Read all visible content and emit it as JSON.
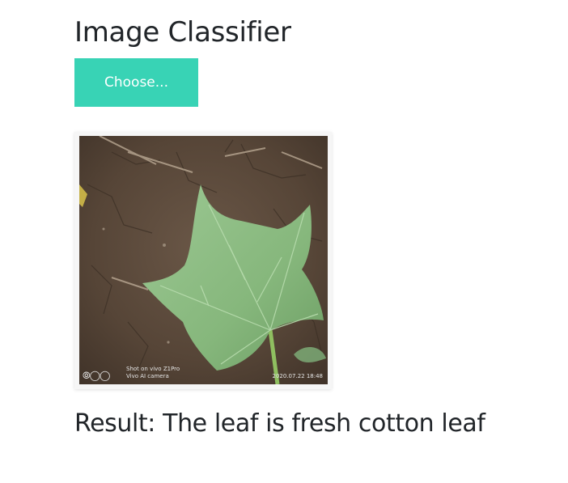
{
  "page": {
    "title": "Image Classifier",
    "choose_label": "Choose...",
    "result_text": "Result: The leaf is fresh cotton leaf"
  },
  "preview": {
    "watermark_logo": "⦾◯◯",
    "watermark_line1": "Shot on vivo Z1Pro",
    "watermark_line2": "Vivo AI camera",
    "watermark_date": "2020.07.22 18:48"
  },
  "colors": {
    "accent": "#38d3b5",
    "text": "#212529",
    "soil": "#5b4a3c",
    "leaf": "#8fbf86"
  }
}
